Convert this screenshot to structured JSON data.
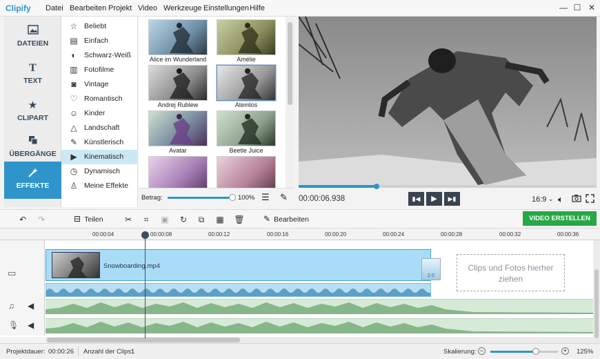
{
  "app": {
    "logo": "Clipify"
  },
  "menu": [
    "Datei",
    "Bearbeiten",
    "Projekt",
    "Video",
    "Werkzeuge",
    "Einstellungen",
    "Hilfe"
  ],
  "window_controls": {
    "minimize": "—",
    "maximize": "☐",
    "close": "✕"
  },
  "leftnav": [
    {
      "label": "DATEIEN",
      "icon": "image-icon"
    },
    {
      "label": "TEXT",
      "icon": "text-icon"
    },
    {
      "label": "CLIPART",
      "icon": "star-icon"
    },
    {
      "label": "ÜBERGÄNGE",
      "icon": "transitions-icon"
    },
    {
      "label": "EFFEKTE",
      "icon": "magic-wand-icon"
    }
  ],
  "filters": [
    {
      "label": "Beliebt",
      "icon": "star-outline-icon"
    },
    {
      "label": "Einfach",
      "icon": "simple-icon"
    },
    {
      "label": "Schwarz-Weiß",
      "icon": "contrast-icon"
    },
    {
      "label": "Fotofilme",
      "icon": "film-icon"
    },
    {
      "label": "Vintage",
      "icon": "camera-icon"
    },
    {
      "label": "Romantisch",
      "icon": "heart-icon"
    },
    {
      "label": "Kinder",
      "icon": "kids-icon"
    },
    {
      "label": "Landschaft",
      "icon": "mountain-icon"
    },
    {
      "label": "Künstlerisch",
      "icon": "brush-icon"
    },
    {
      "label": "Kinematisch",
      "icon": "clapper-icon"
    },
    {
      "label": "Dynamisch",
      "icon": "dynamic-icon"
    },
    {
      "label": "Meine Effekte",
      "icon": "user-icon"
    }
  ],
  "selected_filter": "Kinematisch",
  "effects": [
    "Alice im Wunderland",
    "Amélie",
    "Andrej Rublew",
    "Atemlos",
    "Avatar",
    "Beetle Juice",
    "",
    ""
  ],
  "selected_effect": "Atemlos",
  "intensity": {
    "label": "Betrag:",
    "value": "100%",
    "fraction": 1.0
  },
  "player": {
    "timecode": "00:00:06.938",
    "progress_fraction": 0.26,
    "aspect": "16:9"
  },
  "toolbar": {
    "split_label": "Teilen",
    "edit_label": "Bearbeiten",
    "create_label": "VIDEO ERSTELLEN"
  },
  "ruler": [
    "00:00:04",
    "00:00:08",
    "00:00:12",
    "00:00:16",
    "00:00:20",
    "00:00:24",
    "00:00:28",
    "00:00:32",
    "00:00:36"
  ],
  "timeline": {
    "clip_name": "Snowboarding.mp4",
    "transition_duration": "2.0",
    "dropzone": "Clips und Fotos hierher ziehen"
  },
  "status": {
    "duration_label": "Projektdauer:",
    "duration_value": "00:00:26",
    "clips_label": "Anzahl der Clips:",
    "clips_value": "1",
    "scale_label": "Skalierung:",
    "scale_value": "125%",
    "scale_fraction": 0.7
  },
  "colors": {
    "accent": "#2f94c9",
    "create_button": "#27a844",
    "selected_filter_bg": "#cce8f4"
  }
}
